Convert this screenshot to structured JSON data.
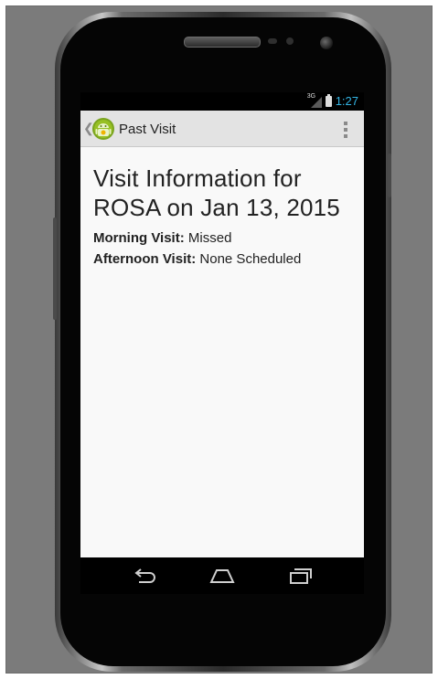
{
  "status_bar": {
    "network_tag": "3G",
    "time": "1:27"
  },
  "action_bar": {
    "title": "Past Visit",
    "icon": "android-app-icon",
    "up_icon": "chevron-left-icon",
    "overflow_icon": "overflow-menu-icon"
  },
  "content": {
    "heading": "Visit Information for ROSA on Jan 13, 2015",
    "rows": [
      {
        "label": "Morning Visit:",
        "value": "Missed"
      },
      {
        "label": "Afternoon Visit:",
        "value": "None Scheduled"
      }
    ]
  },
  "nav_bar": {
    "back_icon": "back-icon",
    "home_icon": "home-icon",
    "recents_icon": "recents-icon"
  },
  "colors": {
    "status_accent": "#33b5e5",
    "action_bar_bg": "#e3e3e3",
    "content_bg": "#f9f9f9",
    "android_green": "#97c024"
  }
}
